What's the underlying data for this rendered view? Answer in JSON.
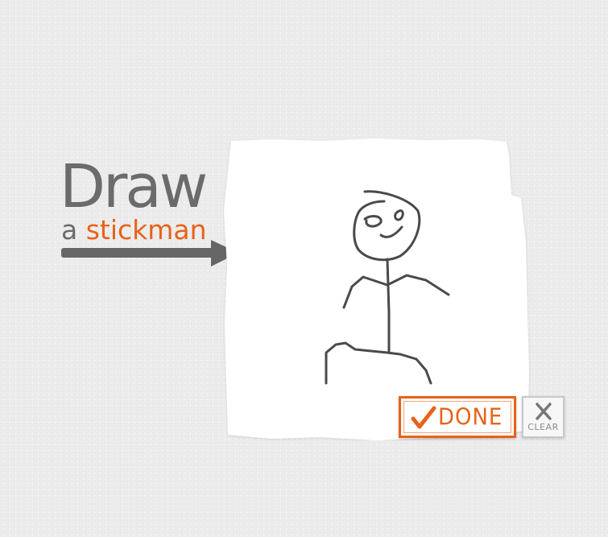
{
  "title": {
    "main": "Draw",
    "sub_prefix": "a",
    "sub_highlight": "stickman"
  },
  "buttons": {
    "done_label": "DONE",
    "clear_label": "CLEAR"
  },
  "colors": {
    "accent": "#e8621a",
    "title_gray": "#6b6b6b",
    "ink": "#4a4a4a",
    "paper": "#ffffff",
    "background": "#ececec"
  },
  "icons": {
    "arrow": "right-arrow-icon",
    "done": "checkmark-icon",
    "clear": "x-icon"
  }
}
